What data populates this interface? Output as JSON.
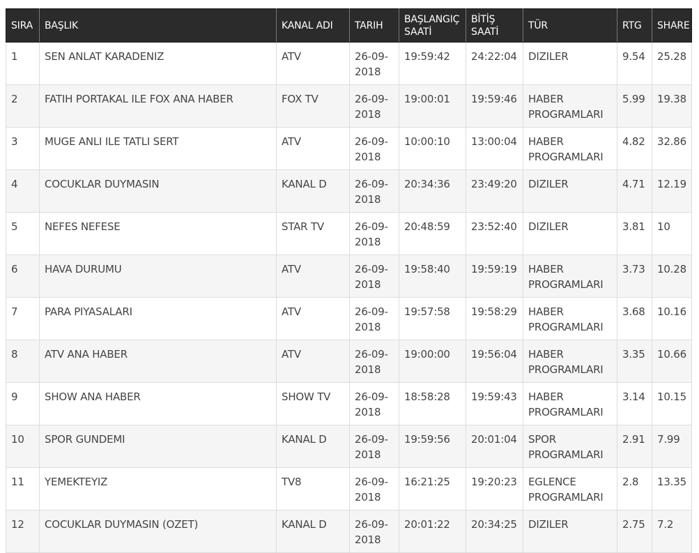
{
  "table": {
    "headers": [
      "SIRA",
      "BAŞLIK",
      "KANAL ADI",
      "TARIH",
      "BAŞLANGIÇ SAATİ",
      "BİTİŞ SAATİ",
      "TÜR",
      "RTG",
      "SHARE"
    ],
    "rows": [
      [
        "1",
        "SEN ANLAT KARADENIZ",
        "ATV",
        "26-09-2018",
        "19:59:42",
        "24:22:04",
        "DIZILER",
        "9.54",
        "25.28"
      ],
      [
        "2",
        "FATIH PORTAKAL ILE FOX ANA HABER",
        "FOX TV",
        "26-09-2018",
        "19:00:01",
        "19:59:46",
        "HABER PROGRAMLARI",
        "5.99",
        "19.38"
      ],
      [
        "3",
        "MUGE ANLI ILE TATLI SERT",
        "ATV",
        "26-09-2018",
        "10:00:10",
        "13:00:04",
        "HABER PROGRAMLARI",
        "4.82",
        "32.86"
      ],
      [
        "4",
        "COCUKLAR DUYMASIN",
        "KANAL D",
        "26-09-2018",
        "20:34:36",
        "23:49:20",
        "DIZILER",
        "4.71",
        "12.19"
      ],
      [
        "5",
        "NEFES NEFESE",
        "STAR TV",
        "26-09-2018",
        "20:48:59",
        "23:52:40",
        "DIZILER",
        "3.81",
        "10"
      ],
      [
        "6",
        "HAVA DURUMU",
        "ATV",
        "26-09-2018",
        "19:58:40",
        "19:59:19",
        "HABER PROGRAMLARI",
        "3.73",
        "10.28"
      ],
      [
        "7",
        "PARA PIYASALARI",
        "ATV",
        "26-09-2018",
        "19:57:58",
        "19:58:29",
        "HABER PROGRAMLARI",
        "3.68",
        "10.16"
      ],
      [
        "8",
        "ATV ANA HABER",
        "ATV",
        "26-09-2018",
        "19:00:00",
        "19:56:04",
        "HABER PROGRAMLARI",
        "3.35",
        "10.66"
      ],
      [
        "9",
        "SHOW ANA HABER",
        "SHOW TV",
        "26-09-2018",
        "18:58:28",
        "19:59:43",
        "HABER PROGRAMLARI",
        "3.14",
        "10.15"
      ],
      [
        "10",
        "SPOR GUNDEMI",
        "KANAL D",
        "26-09-2018",
        "19:59:56",
        "20:01:04",
        "SPOR PROGRAMLARI",
        "2.91",
        "7.99"
      ],
      [
        "11",
        "YEMEKTEYIZ",
        "TV8",
        "26-09-2018",
        "16:21:25",
        "19:20:23",
        "EGLENCE PROGRAMLARI",
        "2.8",
        "13.35"
      ],
      [
        "12",
        "COCUKLAR DUYMASIN (OZET)",
        "KANAL D",
        "26-09-2018",
        "20:01:22",
        "20:34:25",
        "DIZILER",
        "2.75",
        "7.2"
      ]
    ]
  }
}
